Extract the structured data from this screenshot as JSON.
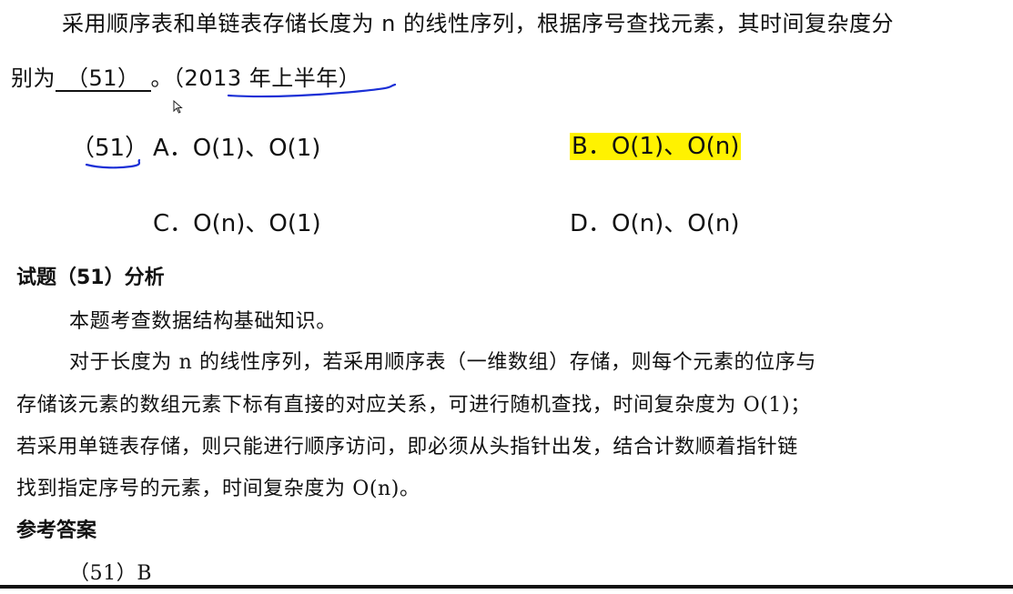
{
  "question": {
    "line1": "采用顺序表和单链表存储长度为 n 的线性序列，根据序号查找元素，其时间复杂度分",
    "line2_prefix": "别为",
    "blank": "（51）",
    "line2_end": "。",
    "source": "（2013 年上半年）"
  },
  "options": {
    "number": "（51）",
    "a": "A．O(1)、O(1)",
    "b": "B．O(1)、O(n)",
    "c": "C．O(n)、O(1)",
    "d": "D．O(n)、O(n)"
  },
  "analysis": {
    "heading": "试题（51）分析",
    "p1": "本题考查数据结构基础知识。",
    "p2_l1": "对于长度为 n 的线性序列，若采用顺序表（一维数组）存储，则每个元素的位序与",
    "p2_l2": "存储该元素的数组元素下标有直接的对应关系，可进行随机查找，时间复杂度为 O(1)；",
    "p2_l3": "若采用单链表存储，则只能进行顺序访问，即必须从头指针出发，结合计数顺着指针链",
    "p2_l4": "找到指定序号的元素，时间复杂度为 O(n)。"
  },
  "answer": {
    "heading": "参考答案",
    "value": "（51）B"
  },
  "colors": {
    "highlight": "#fff200",
    "annotation_ink": "#1a2fd6"
  }
}
